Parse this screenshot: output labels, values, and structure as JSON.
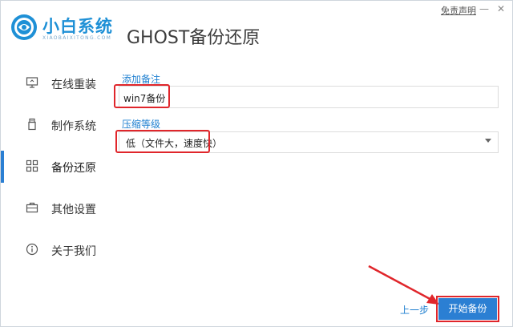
{
  "app": {
    "brand_name": "小白系统",
    "brand_sub": "XIAOBAIXITONG.COM",
    "page_title": "GHOST备份还原",
    "disclaimer": "免责声明",
    "minimize_glyph": "—",
    "close_glyph": "✕"
  },
  "sidebar": {
    "items": [
      {
        "label": "在线重装",
        "icon": "monitor-icon"
      },
      {
        "label": "制作系统",
        "icon": "usb-drive-icon"
      },
      {
        "label": "备份还原",
        "icon": "backup-grid-icon",
        "active": true
      },
      {
        "label": "其他设置",
        "icon": "briefcase-icon"
      },
      {
        "label": "关于我们",
        "icon": "info-icon"
      }
    ]
  },
  "form": {
    "remark_label": "添加备注",
    "remark_value": "win7备份",
    "compress_label": "压缩等级",
    "compress_value": "低（文件大，速度快）"
  },
  "footer": {
    "prev_label": "上一步",
    "start_label": "开始备份"
  },
  "colors": {
    "accent": "#2b7fd3",
    "brand": "#1e90d6",
    "highlight": "#e0262b"
  }
}
